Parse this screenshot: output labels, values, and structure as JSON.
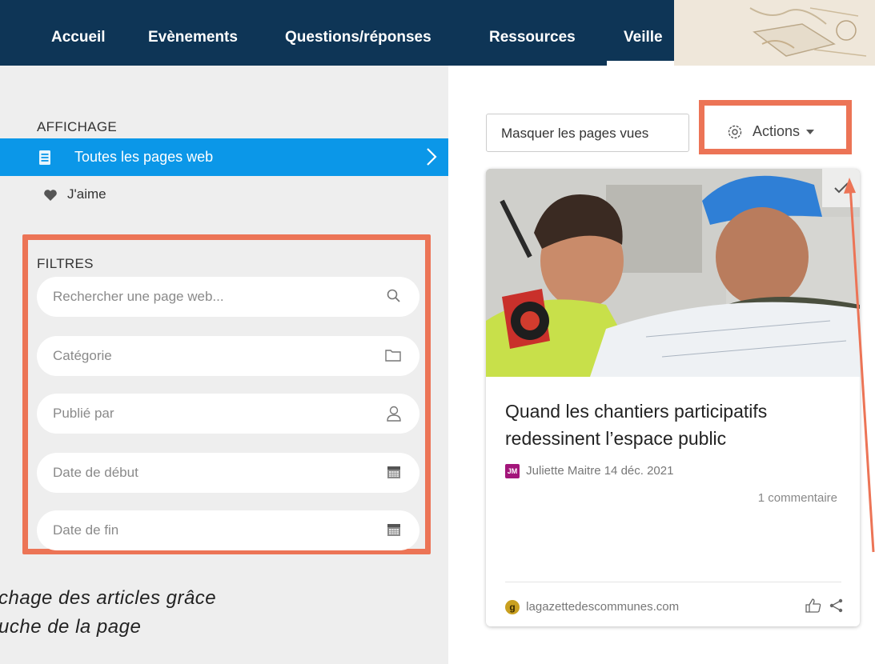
{
  "nav": {
    "items": [
      "Accueil",
      "Evènements",
      "Questions/réponses",
      "Ressources",
      "Veille"
    ],
    "active": "Veille",
    "bg_color": "#0e3556"
  },
  "sidebar": {
    "display_title": "AFFICHAGE",
    "menu": [
      {
        "label": "Toutes les pages web",
        "icon": "document-list-icon",
        "active": true
      },
      {
        "label": "J'aime",
        "icon": "heart-icon",
        "active": false
      }
    ],
    "filters_title": "FILTRES",
    "filters": [
      {
        "placeholder": "Rechercher une page web...",
        "icon": "search-icon"
      },
      {
        "placeholder": "Catégorie",
        "icon": "folder-icon"
      },
      {
        "placeholder": "Publié par",
        "icon": "user-icon"
      },
      {
        "placeholder": "Date de début",
        "icon": "calendar-icon"
      },
      {
        "placeholder": "Date de fin",
        "icon": "calendar-icon"
      }
    ],
    "active_color": "#0b97e8"
  },
  "caption": {
    "line1": "chage des articles grâce",
    "line2": "uche de la page"
  },
  "toolbar": {
    "hide_seen_label": "Masquer les pages vues",
    "actions_label": "Actions"
  },
  "card": {
    "title": "Quand les chantiers participatifs redessinent l’espace public",
    "author_initials": "JM",
    "author": "Juliette Maitre",
    "date": "14 déc. 2021",
    "comments": "1 commentaire",
    "source": "lagazettedescommunes.com",
    "source_initial": "g"
  },
  "highlight_color": "#ec7456"
}
